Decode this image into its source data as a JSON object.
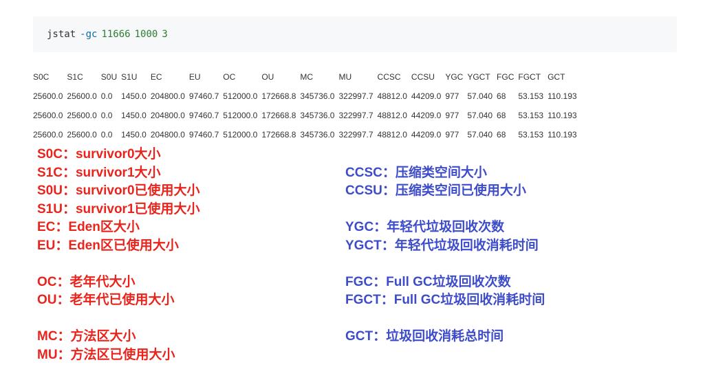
{
  "colors": {
    "left_legend": "#e8241c",
    "right_legend": "#3d4cc9"
  },
  "command": {
    "cmd": "jstat",
    "flag": "-gc",
    "pid": "11666",
    "interval": "1000",
    "count": "3"
  },
  "table": {
    "headers": [
      "S0C",
      "S1C",
      "S0U",
      "S1U",
      "EC",
      "EU",
      "OC",
      "OU",
      "MC",
      "MU",
      "CCSC",
      "CCSU",
      "YGC",
      "YGCT",
      "FGC",
      "FGCT",
      "GCT"
    ],
    "rows": [
      [
        "25600.0",
        "25600.0",
        "0.0",
        "1450.0",
        "204800.0",
        "97460.7",
        "512000.0",
        "172668.8",
        "345736.0",
        "322997.7",
        "48812.0",
        "44209.0",
        "977",
        "57.040",
        "68",
        "53.153",
        "110.193"
      ],
      [
        "25600.0",
        "25600.0",
        "0.0",
        "1450.0",
        "204800.0",
        "97460.7",
        "512000.0",
        "172668.8",
        "345736.0",
        "322997.7",
        "48812.0",
        "44209.0",
        "977",
        "57.040",
        "68",
        "53.153",
        "110.193"
      ],
      [
        "25600.0",
        "25600.0",
        "0.0",
        "1450.0",
        "204800.0",
        "97460.7",
        "512000.0",
        "172668.8",
        "345736.0",
        "322997.7",
        "48812.0",
        "44209.0",
        "977",
        "57.040",
        "68",
        "53.153",
        "110.193"
      ]
    ]
  },
  "legend_left": [
    "S0C：survivor0大小",
    "S1C：survivor1大小",
    "S0U：survivor0已使用大小",
    "S1U：survivor1已使用大小",
    "EC：Eden区大小",
    "EU：Eden区已使用大小",
    "",
    "OC：老年代大小",
    "OU：老年代已使用大小",
    "",
    "MC：方法区大小",
    "MU：方法区已使用大小"
  ],
  "legend_right": [
    "",
    "CCSC：压缩类空间大小",
    "CCSU：压缩类空间已使用大小",
    "",
    "YGC：年轻代垃圾回收次数",
    "YGCT：年轻代垃圾回收消耗时间",
    "",
    "FGC：Full GC垃圾回收次数",
    "FGCT：Full GC垃圾回收消耗时间",
    "",
    "GCT：垃圾回收消耗总时间"
  ]
}
